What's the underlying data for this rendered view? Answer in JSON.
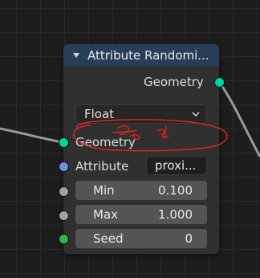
{
  "node": {
    "title": "Attribute Randomi...",
    "output": {
      "label": "Geometry"
    },
    "data_type": {
      "selected": "Float"
    },
    "inputs": {
      "geometry": {
        "label": "Geometry"
      },
      "attribute": {
        "label": "Attribute",
        "value": "proxi..."
      },
      "min": {
        "label": "Min",
        "value": "0.100"
      },
      "max": {
        "label": "Max",
        "value": "1.000"
      },
      "seed": {
        "label": "Seed",
        "value": "0"
      }
    }
  },
  "colors": {
    "header": "#283e58",
    "node_body": "#303030",
    "geometry_socket": "#00d6a3",
    "vector_socket": "#6b8ee6",
    "float_socket": "#a1a1a1",
    "integer_socket": "#35b547",
    "annotation_ink": "#e0241f"
  },
  "icons": {
    "collapse": "triangle-down-icon",
    "dropdown": "chevron-down-icon"
  }
}
